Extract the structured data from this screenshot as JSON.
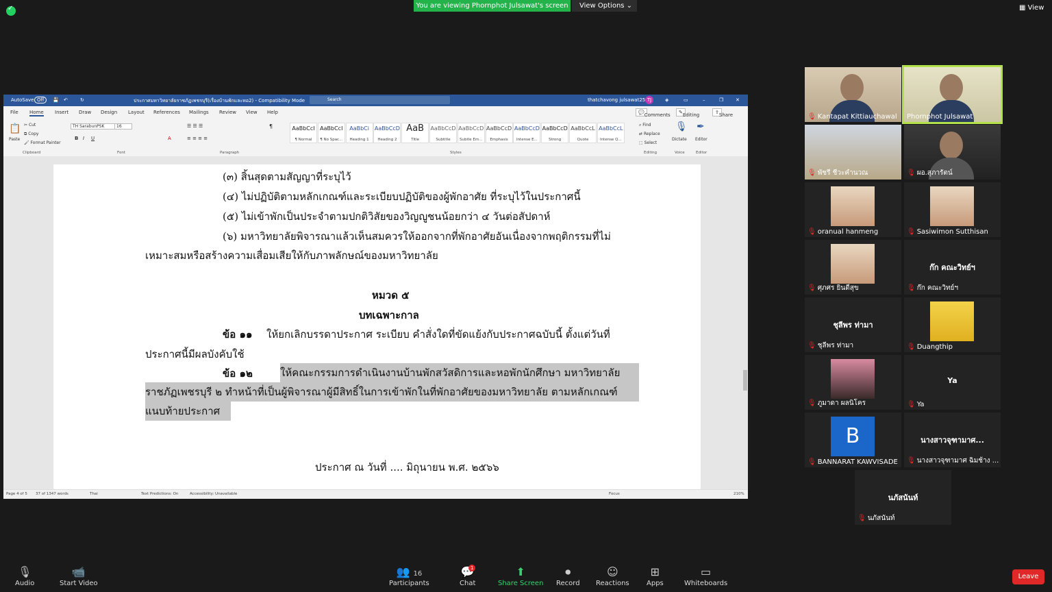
{
  "zoom": {
    "banner": "You are viewing Phornphot Julsawat's screen",
    "view_options": "View Options",
    "view_top": "View",
    "leave": "Leave",
    "participants_count": "16",
    "chat_badge": "1",
    "toolbar": {
      "audio": "Audio",
      "start_video": "Start Video",
      "participants": "Participants",
      "chat": "Chat",
      "share_screen": "Share Screen",
      "record": "Record",
      "reactions": "Reactions",
      "apps": "Apps",
      "whiteboards": "Whiteboards"
    }
  },
  "word": {
    "autosave": "AutoSave",
    "autosave_state": "Off",
    "doc_title": "ประกาศมหาวิทยาลัยราชภัฏเพชรบุรี(เรื่องบ้านพักและหอ2) - Compatibility Mode",
    "search": "Search",
    "user": "thatchavong julsawat2519",
    "tabs": [
      "File",
      "Home",
      "Insert",
      "Draw",
      "Design",
      "Layout",
      "References",
      "Mailings",
      "Review",
      "View",
      "Help"
    ],
    "comments": "Comments",
    "editing": "Editing",
    "share": "Share",
    "clipboard": {
      "paste": "Paste",
      "cut": "Cut",
      "copy": "Copy",
      "format_painter": "Format Painter",
      "group": "Clipboard"
    },
    "font_name": "TH SarabunPSK",
    "font_size": "16",
    "group_font": "Font",
    "group_paragraph": "Paragraph",
    "group_styles": "Styles",
    "group_editing": "Editing",
    "group_voice": "Voice",
    "group_editor": "Editor",
    "styles": [
      {
        "preview": "AaBbCcI",
        "label": "¶ Normal"
      },
      {
        "preview": "AaBbCcI",
        "label": "¶ No Spac..."
      },
      {
        "preview": "AaBbCi",
        "label": "Heading 1"
      },
      {
        "preview": "AaBbCcD",
        "label": "Heading 2"
      },
      {
        "preview": "AaB",
        "label": "Title"
      },
      {
        "preview": "AaBbCcD",
        "label": "Subtitle"
      },
      {
        "preview": "AaBbCcD",
        "label": "Subtle Em..."
      },
      {
        "preview": "AaBbCcD",
        "label": "Emphasis"
      },
      {
        "preview": "AaBbCcD",
        "label": "Intense E..."
      },
      {
        "preview": "AaBbCcD",
        "label": "Strong"
      },
      {
        "preview": "AaBbCcL",
        "label": "Quote"
      },
      {
        "preview": "AaBbCcL",
        "label": "Intense Q..."
      }
    ],
    "find": "Find",
    "replace": "Replace",
    "select": "Select",
    "dictate": "Dictate",
    "editor": "Editor",
    "doc_lines": [
      "(๓) สิ้นสุดตามสัญญาที่ระบุไว้",
      "(๔) ไม่ปฏิบัติตามหลักเกณฑ์และระเบียบปฏิบัติของผู้พักอาศัย ที่ระบุไว้ในประกาศนี้",
      "(๕) ไม่เข้าพักเป็นประจำตามปกติวิสัยของวิญญูชนน้อยกว่า ๔ วันต่อสัปดาห์",
      "(๖) มหาวิทยาลัยพิจารณาแล้วเห็นสมควรให้ออกจากที่พักอาศัยอันเนื่องจากพฤติกรรมที่ไม่",
      "เหมาะสมหรือสร้างความเสื่อมเสียให้กับภาพลักษณ์ของมหาวิทยาลัย"
    ],
    "chapter": "หมวด ๕",
    "chapter_title": "บทเฉพาะกาล",
    "clause11_label": "ข้อ  ๑๑",
    "clause11_text": "ให้ยกเลิกบรรดาประกาศ  ระเบียบ  คำสั่งใดที่ขัดแย้งกับประกาศฉบับนี้  ตั้งแต่วันที่",
    "clause11_cont": "ประกาศนี้มีผลบังคับใช้",
    "clause12_label": "ข้อ    ๑๒",
    "clause12_text": "ให้คณะกรรมการดำเนินงานบ้านพักสวัสดิการและหอพักนักศึกษา  มหาวิทยาลัย",
    "clause12_line2": "ราชภัฏเพชรบุรี ๒ ทำหน้าที่เป็นผู้พิจารณาผู้มีสิทธิ์ในการเข้าพักในที่พักอาศัยของมหาวิทยาลัย ตามหลักเกณฑ์",
    "clause12_line3": "แนบท้ายประกาศ",
    "announce": "ประกาศ ณ วันที่    .... มิถุนายน  พ.ศ. ๒๕๖๖",
    "status": {
      "page": "Page 4 of 5",
      "words": "37 of 1347 words",
      "lang": "Thai",
      "predictions": "Text Predictions: On",
      "accessibility": "Accessibility: Unavailable",
      "focus": "Focus",
      "zoom": "210%"
    }
  },
  "participants": [
    {
      "name": "Kantapat Kittiauchawal",
      "type": "video"
    },
    {
      "name": "Phornphot Julsawat",
      "type": "video",
      "active": true
    },
    {
      "name": "พัชรี ชีวะคำนวณ",
      "type": "photo"
    },
    {
      "name": "ผอ.สุภารัตน์",
      "type": "video"
    },
    {
      "name": "oranual hanmeng",
      "type": "photo"
    },
    {
      "name": "Sasiwimon Sutthisan",
      "type": "photo"
    },
    {
      "name": "ศุภศร ยินดีสุข",
      "type": "photo"
    },
    {
      "name": "ก๊ก คณะวิทย์ฯ",
      "type": "text",
      "big": "ก๊ก คณะวิทย์ฯ"
    },
    {
      "name": "ชุลีพร ท่ามา",
      "type": "text",
      "big": "ชุลีพร ท่ามา"
    },
    {
      "name": "Duangthip",
      "type": "photo"
    },
    {
      "name": "ภูมาดา ผลนิโคร",
      "type": "photo"
    },
    {
      "name": "Ya",
      "type": "text",
      "big": "Ya"
    },
    {
      "name": "BANNARAT KAWVISADE",
      "type": "letter",
      "letter": "B"
    },
    {
      "name": "นางสาวจุฑามาศ ฉิมช้าง ...",
      "type": "text",
      "big": "นางสาวจุฑามาศ..."
    },
    {
      "name": "นภัสนันท์",
      "type": "text",
      "big": "นภัสนันท์"
    }
  ]
}
